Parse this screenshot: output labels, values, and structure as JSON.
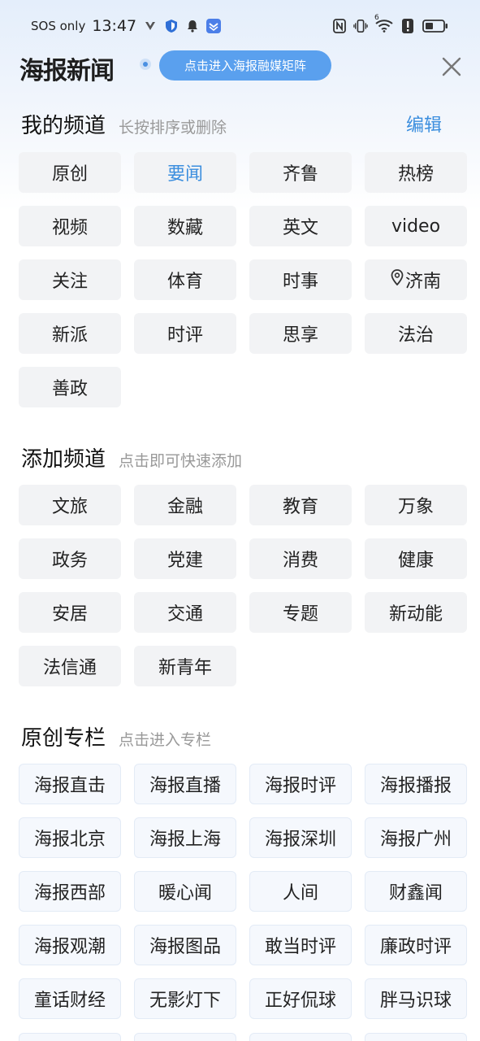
{
  "status_bar": {
    "sos": "SOS only",
    "time": "13:47",
    "wifi_label": "6"
  },
  "header": {
    "logo": "海报新闻",
    "matrix_button": "点击进入海报融媒矩阵"
  },
  "my_channels": {
    "title": "我的频道",
    "subtitle": "长按排序或删除",
    "edit": "编辑",
    "items": [
      {
        "label": "原创"
      },
      {
        "label": "要闻",
        "active": true
      },
      {
        "label": "齐鲁"
      },
      {
        "label": "热榜"
      },
      {
        "label": "视频"
      },
      {
        "label": "数藏"
      },
      {
        "label": "英文"
      },
      {
        "label": "video"
      },
      {
        "label": "关注"
      },
      {
        "label": "体育"
      },
      {
        "label": "时事"
      },
      {
        "label": "济南",
        "icon": "location-pin-icon"
      },
      {
        "label": "新派"
      },
      {
        "label": "时评"
      },
      {
        "label": "思享"
      },
      {
        "label": "法治"
      },
      {
        "label": "善政"
      }
    ]
  },
  "add_channels": {
    "title": "添加频道",
    "subtitle": "点击即可快速添加",
    "items": [
      {
        "label": "文旅"
      },
      {
        "label": "金融"
      },
      {
        "label": "教育"
      },
      {
        "label": "万象"
      },
      {
        "label": "政务"
      },
      {
        "label": "党建"
      },
      {
        "label": "消费"
      },
      {
        "label": "健康"
      },
      {
        "label": "安居"
      },
      {
        "label": "交通"
      },
      {
        "label": "专题"
      },
      {
        "label": "新动能"
      },
      {
        "label": "法信通"
      },
      {
        "label": "新青年"
      }
    ]
  },
  "columns": {
    "title": "原创专栏",
    "subtitle": "点击进入专栏",
    "items": [
      {
        "label": "海报直击"
      },
      {
        "label": "海报直播"
      },
      {
        "label": "海报时评"
      },
      {
        "label": "海报播报"
      },
      {
        "label": "海报北京"
      },
      {
        "label": "海报上海"
      },
      {
        "label": "海报深圳"
      },
      {
        "label": "海报广州"
      },
      {
        "label": "海报西部"
      },
      {
        "label": "暖心闻"
      },
      {
        "label": "人间"
      },
      {
        "label": "财鑫闻"
      },
      {
        "label": "海报观潮"
      },
      {
        "label": "海报图品"
      },
      {
        "label": "敢当时评"
      },
      {
        "label": "廉政时评"
      },
      {
        "label": "童话财经"
      },
      {
        "label": "无影灯下"
      },
      {
        "label": "正好侃球"
      },
      {
        "label": "胖马识球"
      }
    ]
  },
  "colors": {
    "accent": "#3b8ede",
    "button": "#5aa0ee",
    "chip_bg": "#f2f3f5"
  }
}
